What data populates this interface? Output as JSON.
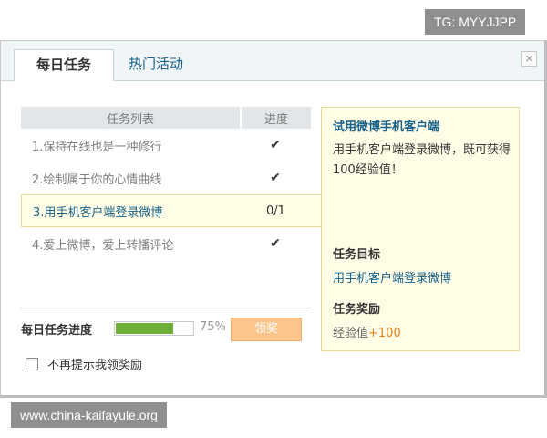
{
  "watermarks": {
    "top": "TG: MYYJJPP",
    "bottom": "www.china-kaifayule.org"
  },
  "tabs": [
    {
      "label": "每日任务",
      "active": true
    },
    {
      "label": "热门活动",
      "active": false
    }
  ],
  "close_symbol": "×",
  "task_table": {
    "header_name": "任务列表",
    "header_progress": "进度",
    "rows": [
      {
        "name": "1.保持在线也是一种修行",
        "progress": "✔",
        "done": true
      },
      {
        "name": "2.绘制属于你的心情曲线",
        "progress": "✔",
        "done": true
      },
      {
        "name": "3.用手机客户端登录微博",
        "progress": "0/1",
        "done": false
      },
      {
        "name": "4.爱上微博，爱上转播评论",
        "progress": "✔",
        "done": true
      }
    ]
  },
  "daily_progress": {
    "label": "每日任务进度",
    "value": 0.75,
    "percent_text": "75%",
    "claim_label": "领奖"
  },
  "dont_remind": {
    "label": "不再提示我领奖励",
    "checked": false
  },
  "detail": {
    "title": "试用微博手机客户端",
    "description": "用手机客户端登录微博，既可获得100经验值！",
    "goal_heading": "任务目标",
    "goal_text": "用手机客户端登录微博",
    "reward_heading": "任务奖励",
    "reward_label": "经验值",
    "reward_amount": "+100"
  },
  "colors": {
    "accent": "#16608a",
    "progress_fill": "#6fae3a",
    "claim_button": "#fcc58b",
    "reward": "#e07f1c"
  }
}
